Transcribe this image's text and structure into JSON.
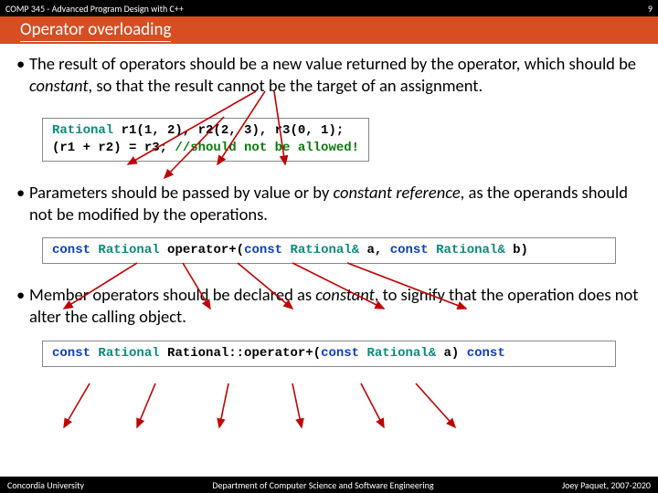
{
  "header": {
    "course": "COMP 345 - Advanced Program Design with C++",
    "slide_number": "9",
    "title": "Operator overloading"
  },
  "bullets": {
    "b1_pre": "The result of operators should be a new value returned by the operator, which should be ",
    "b1_kw": "constant",
    "b1_post": ", so that the result cannot be the target of an assignment.",
    "b2_pre": "Parameters should be passed by value or  by ",
    "b2_kw": "constant reference",
    "b2_post": ", as the operands should not be modified by the operations.",
    "b3_pre": "Member operators should be declared as ",
    "b3_kw": "constant",
    "b3_post": ", to signify that the operation does not alter the calling object."
  },
  "code": {
    "c1": {
      "l1_typ": "Rational",
      "l1_rest": " r1(1, 2), r2(2, 3), r3(0, 1);",
      "l2_lhs": "(r1 + r2) = r3; ",
      "l2_cm": "//should not be allowed!"
    },
    "c2": {
      "kw1": "const",
      "sp": " ",
      "typ": "Rational",
      "fn": " operator+(",
      "kw2": "const",
      "t2": " Rational&",
      "a1": " a, ",
      "kw3": "const",
      "t3": " Rational&",
      "a2": " b)"
    },
    "c3": {
      "kw1": "const",
      "sp": " ",
      "typ": "Rational",
      "cls": " Rational::operator+(",
      "kw2": "const",
      "t2": " Rational&",
      "a1": " a) ",
      "kw3": "const"
    }
  },
  "footer": {
    "left": "Concordia University",
    "mid": "Department of Computer Science and Software Engineering",
    "right": "Joey Paquet, 2007-2020"
  }
}
